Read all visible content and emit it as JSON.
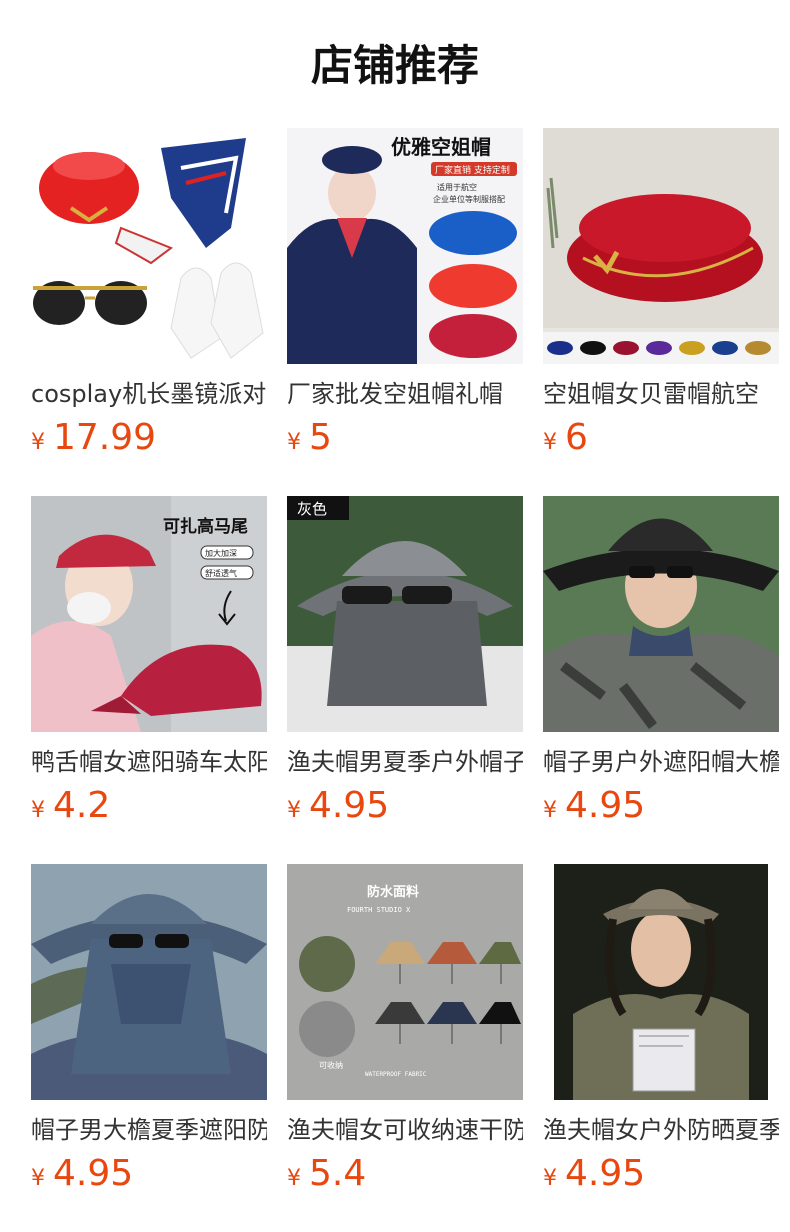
{
  "header": {
    "title": "店铺推荐"
  },
  "products": [
    {
      "name": "cosplay机长墨镜派对",
      "currency": "¥",
      "price": "17.99",
      "image": "stewardess-hat-set-image",
      "badge": ""
    },
    {
      "name": "厂家批发空姐帽礼帽",
      "currency": "¥",
      "price": "5",
      "image": "stewardess-hat-model-image",
      "badge": "优雅空姐帽",
      "sub_badge": "厂家直销 支持定制",
      "caption": "适用于航空\n企业单位等制服搭配"
    },
    {
      "name": "空姐帽女贝雷帽航空",
      "currency": "¥",
      "price": "6",
      "image": "red-beret-image",
      "badge": ""
    },
    {
      "name": "鸭舌帽女遮阳骑车太阳",
      "currency": "¥",
      "price": "4.2",
      "image": "red-baseball-cap-image",
      "badge": "可扎高马尾",
      "tags": [
        "加大加深",
        "舒适透气"
      ]
    },
    {
      "name": "渔夫帽男夏季户外帽子",
      "currency": "¥",
      "price": "4.95",
      "image": "grey-sun-hat-image",
      "badge": "灰色"
    },
    {
      "name": "帽子男户外遮阳帽大檐",
      "currency": "¥",
      "price": "4.95",
      "image": "black-bucket-hat-image",
      "badge": ""
    },
    {
      "name": "帽子男大檐夏季遮阳防",
      "currency": "¥",
      "price": "4.95",
      "image": "blue-face-cover-hat-image",
      "badge": ""
    },
    {
      "name": "渔夫帽女可收纳速干防",
      "currency": "¥",
      "price": "5.4",
      "image": "bucket-hat-colors-image",
      "badge": "防水面料",
      "caption": "可收纳"
    },
    {
      "name": "渔夫帽女户外防晒夏季",
      "currency": "¥",
      "price": "4.95",
      "image": "khaki-bucket-hat-image",
      "badge": ""
    }
  ]
}
